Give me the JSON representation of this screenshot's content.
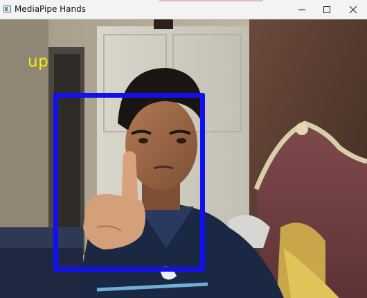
{
  "window": {
    "title": "MediaPipe Hands",
    "controls": [
      "minimize-icon",
      "maximize-icon",
      "close-icon"
    ]
  },
  "overlay": {
    "gesture_label": "up",
    "label_color": "#f4f000",
    "box_color": "#1010f0"
  }
}
